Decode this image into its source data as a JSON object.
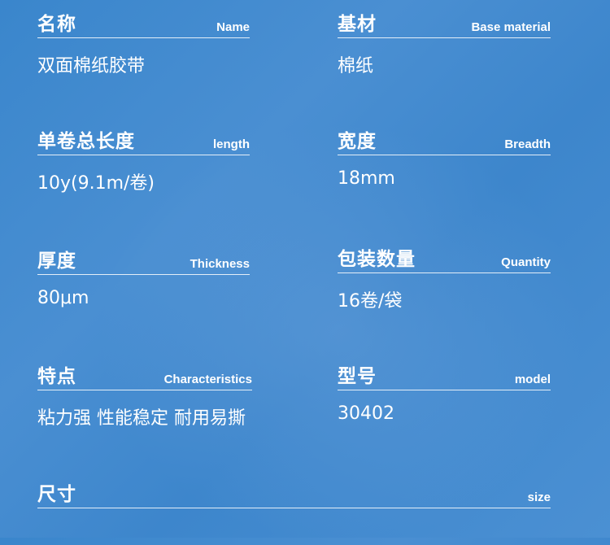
{
  "fields": [
    {
      "zh": "名称",
      "en": "Name",
      "value": "双面棉纸胶带"
    },
    {
      "zh": "基材",
      "en": "Base material",
      "value": "棉纸"
    },
    {
      "zh": "单卷总长度",
      "en": "length",
      "value": "10y(9.1m/卷)"
    },
    {
      "zh": "宽度",
      "en": "Breadth",
      "value": "18mm"
    },
    {
      "zh": "厚度",
      "en": "Thickness",
      "value": "80μm"
    },
    {
      "zh": "包装数量",
      "en": "Quantity",
      "value": "16卷/袋"
    },
    {
      "zh": "特点",
      "en": "Characteristics",
      "value": "粘力强 性能稳定 耐用易撕"
    },
    {
      "zh": "型号",
      "en": "model",
      "value": "30402"
    },
    {
      "zh": "尺寸",
      "en": "size",
      "value": ""
    }
  ]
}
